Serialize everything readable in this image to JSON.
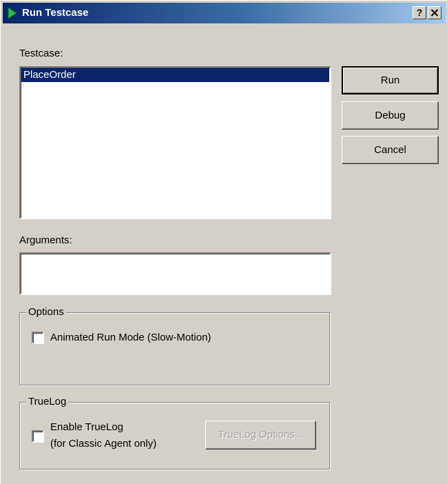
{
  "window": {
    "title": "Run Testcase",
    "help_label": "?",
    "close_label": "✕"
  },
  "testcase": {
    "label": "Testcase:",
    "items": [
      {
        "label": "PlaceOrder",
        "selected": true
      }
    ]
  },
  "arguments": {
    "label": "Arguments:",
    "value": ""
  },
  "buttons": {
    "run": "Run",
    "debug": "Debug",
    "cancel": "Cancel"
  },
  "options": {
    "legend": "Options",
    "animated_label": "Animated Run Mode (Slow-Motion)",
    "animated_checked": false
  },
  "truelog": {
    "legend": "TrueLog",
    "enable_label_line1": "Enable TrueLog",
    "enable_label_line2": "(for Classic Agent only)",
    "enable_checked": false,
    "options_button": "TrueLog Options..."
  }
}
